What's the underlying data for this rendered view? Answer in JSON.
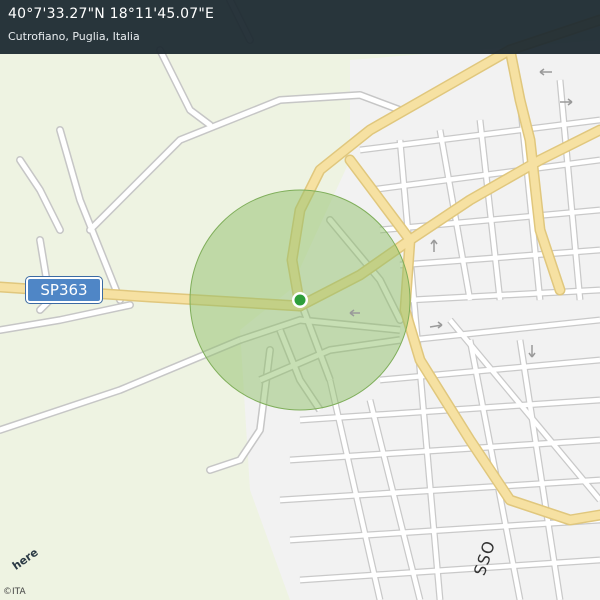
{
  "header": {
    "coordinates": "40°7'33.27\"N 18°11'45.07\"E",
    "place": "Cutrofiano, Puglia, Italia"
  },
  "map": {
    "road_shield": "SP363",
    "road_label": "SSO",
    "logo": "here",
    "copyright": "©ITA",
    "accuracy_circle_color": "#8fbf6a",
    "location_marker_color": "#2e9e3b",
    "urban_area_color": "#f2f2f2",
    "rural_area_color": "#eef3e2",
    "major_road_color": "#f4dd9c",
    "shield_color": "#4f86c6"
  }
}
